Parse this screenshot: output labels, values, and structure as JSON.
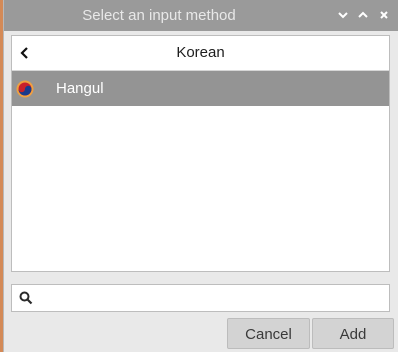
{
  "window": {
    "title": "Select an input method",
    "controls": [
      "minimize",
      "maximize",
      "close"
    ]
  },
  "list": {
    "header_label": "Korean",
    "back_icon": "chevron-left-icon",
    "items": [
      {
        "label": "Hangul",
        "icon": "taegeuk-icon",
        "selected": true
      }
    ]
  },
  "search": {
    "icon": "search-icon",
    "value": "",
    "placeholder": ""
  },
  "buttons": {
    "cancel_label": "Cancel",
    "add_label": "Add"
  },
  "colors": {
    "titlebar": "#9a9a9a",
    "selected_row": "#949494",
    "window_bg": "#e9e9e9",
    "button_bg": "#d3d3d3"
  }
}
